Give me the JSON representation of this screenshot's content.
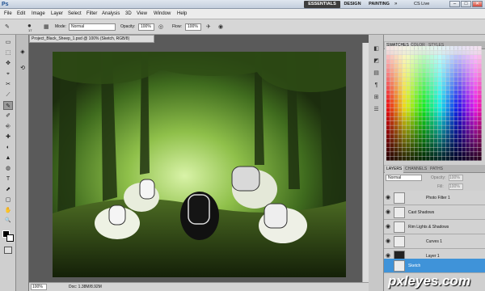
{
  "app": {
    "logo": "Ps",
    "workspaces": [
      "ESSENTIALS",
      "DESIGN",
      "PAINTING"
    ],
    "more": "»",
    "cs_live": "CS Live"
  },
  "window_buttons": [
    "–",
    "□",
    "✕"
  ],
  "menu": [
    "File",
    "Edit",
    "Image",
    "Layer",
    "Select",
    "Filter",
    "Analysis",
    "3D",
    "View",
    "Window",
    "Help"
  ],
  "options": {
    "brush_size": "17",
    "mode_label": "Mode:",
    "mode_value": "Normal",
    "opacity_label": "Opacity:",
    "opacity_value": "100%",
    "flow_label": "Flow:",
    "flow_value": "100%"
  },
  "document": {
    "tab_title": "Project_Black_Sheep_1.psd @ 100% (Sketch, RGB/8)",
    "zoom": "100%",
    "doc_info": "Doc: 1.38M/8.92M"
  },
  "panels": {
    "swatch_tabs": [
      "SWATCHES",
      "COLOR",
      "STYLES"
    ],
    "layer_tabs": [
      "LAYERS",
      "CHANNELS",
      "PATHS"
    ],
    "blend_mode": "Normal",
    "opacity_label": "Opacity:",
    "opacity_value": "100%",
    "fill_label": "Fill:",
    "fill_value": "100%"
  },
  "layers": [
    {
      "name": "Photo Filter 1"
    },
    {
      "name": "Cast Shadows"
    },
    {
      "name": "Rim Lights & Shadows"
    },
    {
      "name": "Curves 1"
    },
    {
      "name": "Layer 1"
    },
    {
      "name": "Sketch",
      "selected": true
    }
  ],
  "tools": [
    "▭",
    "⬚",
    "✥",
    "⌖",
    "✂",
    "⟋",
    "✎",
    "✐",
    "⎆",
    "✚",
    "◐",
    "▲",
    "◍",
    "T",
    "⬈",
    "▢",
    "✋",
    "🔍"
  ],
  "dock_icons": [
    "◧",
    "◩",
    "▤",
    "¶",
    "⊞",
    "☰"
  ],
  "watermark": "pxleyes.com",
  "colors": {
    "accent": "#3f93d9",
    "workspace_active": "#3d3d3d"
  }
}
